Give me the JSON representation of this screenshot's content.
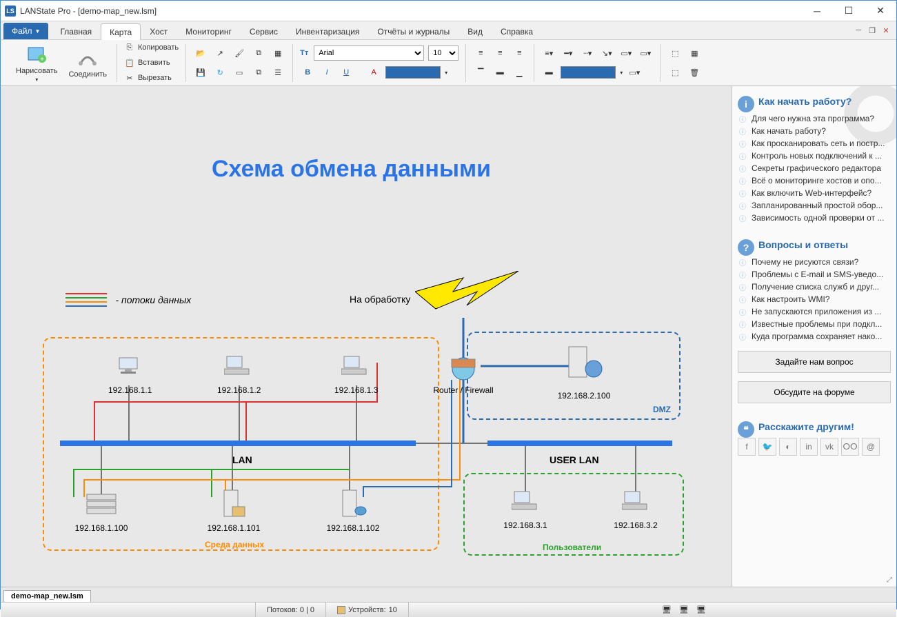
{
  "window": {
    "title": "LANState Pro - [demo-map_new.lsm]"
  },
  "menubar": {
    "file": "Файл",
    "tabs": [
      "Главная",
      "Карта",
      "Хост",
      "Мониторинг",
      "Сервис",
      "Инвентаризация",
      "Отчёты и журналы",
      "Вид",
      "Справка"
    ],
    "active_index": 1
  },
  "ribbon": {
    "draw": "Нарисовать",
    "connect": "Соединить",
    "copy": "Копировать",
    "paste": "Вставить",
    "cut": "Вырезать",
    "font_name": "Arial",
    "font_size": "10"
  },
  "map": {
    "title": "Схема обмена данными",
    "legend_label": "- потоки данных",
    "processing_label": "На обработку",
    "lan_label": "LAN",
    "userlan_label": "USER LAN",
    "dmz_label": "DMZ",
    "env_label": "Среда данных",
    "users_label": "Пользователи",
    "router_label": "Router / Firewall",
    "nodes": {
      "pc1": "192.168.1.1",
      "pc2": "192.168.1.2",
      "pc3": "192.168.1.3",
      "srv1": "192.168.1.100",
      "srv2": "192.168.1.101",
      "srv3": "192.168.1.102",
      "dmz": "192.168.2.100",
      "u1": "192.168.3.1",
      "u2": "192.168.3.2"
    }
  },
  "sidepanel": {
    "sect1_title": "Как начать работу?",
    "sect1_items": [
      "Для чего нужна эта программа?",
      "Как начать работу?",
      "Как просканировать сеть и постр...",
      "Контроль новых подключений к ...",
      "Секреты графического редактора",
      "Всё о мониторинге хостов и опо...",
      "Как включить Web-интерфейс?",
      "Запланированный простой обор...",
      "Зависимость одной проверки от ..."
    ],
    "sect2_title": "Вопросы и ответы",
    "sect2_items": [
      "Почему не рисуются связи?",
      "Проблемы с E-mail и SMS-уведо...",
      "Получение списка служб и друг...",
      "Как настроить WMI?",
      "Не запускаются приложения из ...",
      "Известные проблемы при подкл...",
      "Куда программа сохраняет нако..."
    ],
    "btn_ask": "Задайте нам вопрос",
    "btn_forum": "Обсудите на форуме",
    "sect3_title": "Расскажите другим!"
  },
  "doctab": "demo-map_new.lsm",
  "statusbar": {
    "threads": "Потоков: 0 | 0",
    "devices_label": "Устройств:",
    "devices_count": "10"
  }
}
